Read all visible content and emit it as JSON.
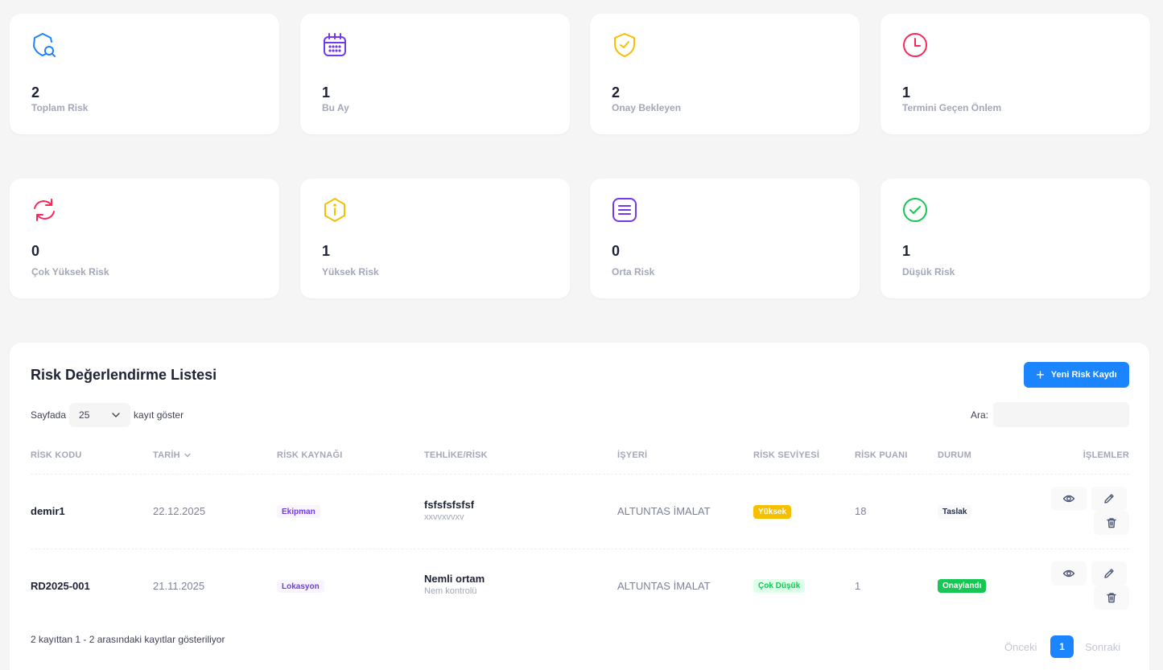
{
  "stats_row1": [
    {
      "value": "2",
      "label": "Toplam Risk",
      "icon": "shield-search-icon"
    },
    {
      "value": "1",
      "label": "Bu Ay",
      "icon": "calendar-icon"
    },
    {
      "value": "2",
      "label": "Onay Bekleyen",
      "icon": "shield-check-icon"
    },
    {
      "value": "1",
      "label": "Termini Geçen Önlem",
      "icon": "clock-icon"
    }
  ],
  "stats_row2": [
    {
      "value": "0",
      "label": "Çok Yüksek Risk",
      "icon": "refresh-icon"
    },
    {
      "value": "1",
      "label": "Yüksek Risk",
      "icon": "info-hexagon-icon"
    },
    {
      "value": "0",
      "label": "Orta Risk",
      "icon": "list-icon"
    },
    {
      "value": "1",
      "label": "Düşük Risk",
      "icon": "check-circle-icon"
    }
  ],
  "colors": {
    "primary": "#1b84ff",
    "purple": "#7239ea",
    "yellow": "#f6c000",
    "red": "#f8285a",
    "green": "#17c653"
  },
  "list": {
    "title": "Risk Değerlendirme Listesi",
    "new_button": "Yeni Risk Kaydı",
    "length_prefix": "Sayfada",
    "length_value": "25",
    "length_suffix": "kayıt göster",
    "search_label": "Ara:",
    "search_value": "",
    "columns": [
      "RİSK KODU",
      "TARİH",
      "RİSK KAYNAĞI",
      "TEHLİKE/RİSK",
      "İŞYERİ",
      "RİSK SEVİYESİ",
      "RİSK PUANI",
      "DURUM",
      "İŞLEMLER"
    ],
    "rows": [
      {
        "code": "demir1",
        "date": "22.12.2025",
        "source": "Ekipman",
        "hazard": "fsfsfsfsfsf",
        "hazard_sub": "xxvvxvvxv",
        "workplace": "ALTUNTAS İMALAT",
        "level": "Yüksek",
        "score": "18",
        "status": "Taslak"
      },
      {
        "code": "RD2025-001",
        "date": "21.11.2025",
        "source": "Lokasyon",
        "hazard": "Nemli ortam",
        "hazard_sub": "Nem kontrolü",
        "workplace": "ALTUNTAS İMALAT",
        "level": "Çok Düşük",
        "score": "1",
        "status": "Onaylandı"
      }
    ],
    "info": "2 kayıttan 1 - 2 arasındaki kayıtlar gösteriliyor",
    "pagination": {
      "prev": "Önceki",
      "current": "1",
      "next": "Sonraki"
    }
  }
}
